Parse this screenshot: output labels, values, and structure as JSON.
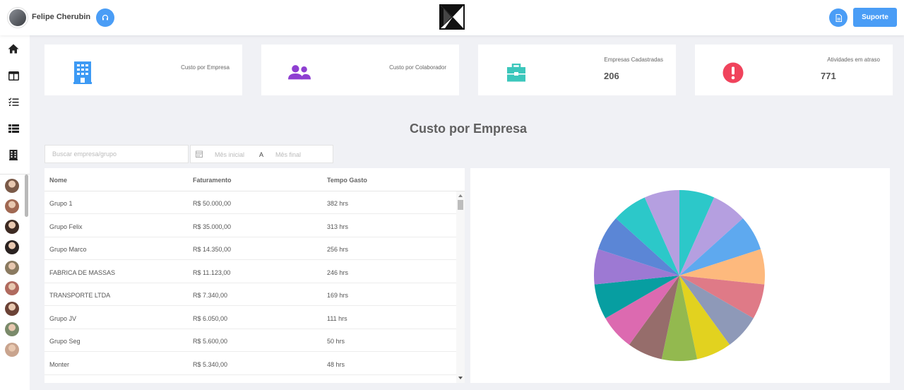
{
  "header": {
    "user_name": "Felipe Cherubin",
    "support_label": "Suporte"
  },
  "cards": [
    {
      "label": "Custo por Empresa",
      "value": "",
      "icon": "building-icon",
      "color": "#3d9af4"
    },
    {
      "label": "Custo por Colaborador",
      "value": "",
      "icon": "users-icon",
      "color": "#8e3fd1"
    },
    {
      "label": "Empresas Cadastradas",
      "value": "206",
      "icon": "briefcase-icon",
      "color": "#3cc7bc"
    },
    {
      "label": "Atividades em atraso",
      "value": "771",
      "icon": "alert-icon",
      "color": "#f0435c"
    }
  ],
  "section_title": "Custo por Empresa",
  "filters": {
    "search_placeholder": "Buscar empresa/grupo",
    "start_placeholder": "Mês inicial",
    "separator": "A",
    "end_placeholder": "Mês final"
  },
  "table": {
    "headers": [
      "Nome",
      "Faturamento",
      "Tempo Gasto"
    ],
    "rows": [
      [
        "Grupo 1",
        "R$ 50.000,00",
        "382 hrs"
      ],
      [
        "Grupo Felix",
        "R$ 35.000,00",
        "313 hrs"
      ],
      [
        "Grupo Marco",
        "R$ 14.350,00",
        "256 hrs"
      ],
      [
        "FABRICA DE MASSAS",
        "R$ 11.123,00",
        "246 hrs"
      ],
      [
        "TRANSPORTE LTDA",
        "R$ 7.340,00",
        "169 hrs"
      ],
      [
        "Grupo JV",
        "R$ 6.050,00",
        "111 hrs"
      ],
      [
        "Grupo Seg",
        "R$ 5.600,00",
        "50 hrs"
      ],
      [
        "Monter",
        "R$ 5.340,00",
        "48 hrs"
      ]
    ]
  },
  "chart_data": {
    "type": "pie",
    "values": [
      1,
      1,
      1,
      1,
      1,
      1,
      1,
      1,
      1,
      1,
      1,
      1,
      1,
      1,
      1
    ],
    "colors": [
      "#2cc8c9",
      "#b59fe0",
      "#5ea9ef",
      "#fdb97d",
      "#df7a87",
      "#8e99b8",
      "#e2d21f",
      "#93b94f",
      "#966d6b",
      "#dc6ab0",
      "#079ea1",
      "#9d79d3",
      "#5b86d6"
    ],
    "title": "",
    "xlabel": "",
    "ylabel": ""
  },
  "sidebar": {
    "contacts": [
      "#7a5a48",
      "#a06852",
      "#3d2a22",
      "#2a2220",
      "#8a7a60",
      "#b06a5e",
      "#6b4236",
      "#7a8a6a",
      "#c9a48e"
    ]
  }
}
